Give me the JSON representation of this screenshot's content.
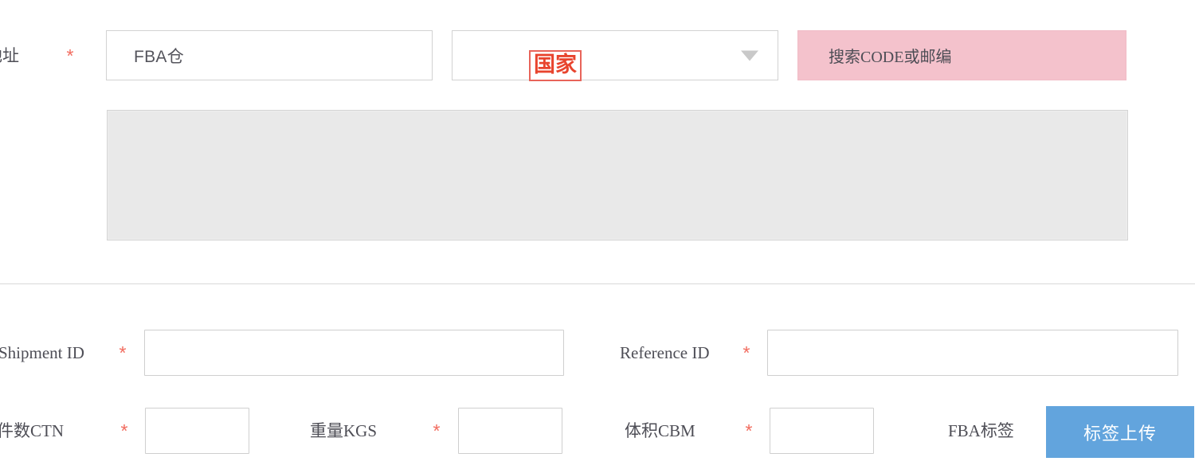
{
  "form": {
    "address_section": {
      "label": "地址",
      "required_marker": "*",
      "warehouse_field": {
        "name": "FBA仓",
        "value": "FBA仓"
      },
      "country_select": {
        "value": "国家",
        "caret": "chevron-down-icon",
        "highlight_color": "#e8442e"
      },
      "search_field": {
        "placeholder": "搜索CODE或邮编",
        "background_color": "#f4c2cc"
      },
      "address_textarea": {
        "value": "",
        "background_color": "#e9e9e9"
      }
    },
    "shipment_section": {
      "shipment_id": {
        "label": "Shipment ID",
        "required_marker": "*",
        "value": ""
      },
      "reference_id": {
        "label": "Reference ID",
        "required_marker": "*",
        "value": ""
      },
      "ctn": {
        "label": "件数CTN",
        "required_marker": "*",
        "value": ""
      },
      "kgs": {
        "label": "重量KGS",
        "required_marker": "*",
        "value": ""
      },
      "cbm": {
        "label": "体积CBM",
        "required_marker": "*",
        "value": ""
      },
      "fba_label": {
        "label": "FBA标签"
      },
      "upload_button": {
        "label": "标签上传",
        "color": "#62a4dd"
      }
    }
  }
}
